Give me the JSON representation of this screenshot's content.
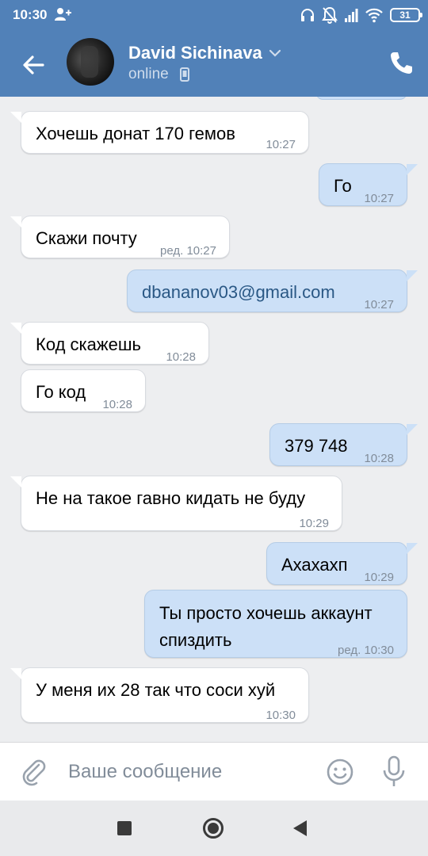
{
  "status_bar": {
    "time": "10:30",
    "battery": "31",
    "icons": [
      "add-user-icon",
      "headphones-icon",
      "notifications-off-icon",
      "signal-icon",
      "wifi-icon",
      "battery-icon"
    ]
  },
  "header": {
    "contact_name": "David Sichinava",
    "status": "online",
    "accent_color": "#5181b8"
  },
  "messages": [
    {
      "direction": "in",
      "text": "Хочешь донат 170 гемов",
      "time": "10:27"
    },
    {
      "direction": "out",
      "text": "Го",
      "time": "10:27"
    },
    {
      "direction": "in",
      "text": "Скажи почту",
      "time": "ред. 10:27"
    },
    {
      "direction": "out",
      "text": "dbananov03@gmail.com",
      "time": "10:27",
      "link_color": "#2a5885"
    },
    {
      "direction": "in",
      "text": "Код скажешь",
      "time": "10:28"
    },
    {
      "direction": "in",
      "text": "Го код",
      "time": "10:28"
    },
    {
      "direction": "out",
      "text": "379 748",
      "time": "10:28"
    },
    {
      "direction": "in",
      "text": "Не на такое гавно кидать не буду",
      "time": "10:29"
    },
    {
      "direction": "out",
      "text": "Ахахахп",
      "time": "10:29"
    },
    {
      "direction": "out",
      "text": "Ты просто хочешь аккаунт\nспиздить",
      "time": "ред. 10:30"
    },
    {
      "direction": "in",
      "text": "У меня их 28 так что соси хуй",
      "time": "10:30"
    }
  ],
  "composer": {
    "placeholder": "Ваше сообщение"
  },
  "colors": {
    "incoming_bubble": "#ffffff",
    "outgoing_bubble": "#cce0f7",
    "chat_background": "#edeef0"
  }
}
